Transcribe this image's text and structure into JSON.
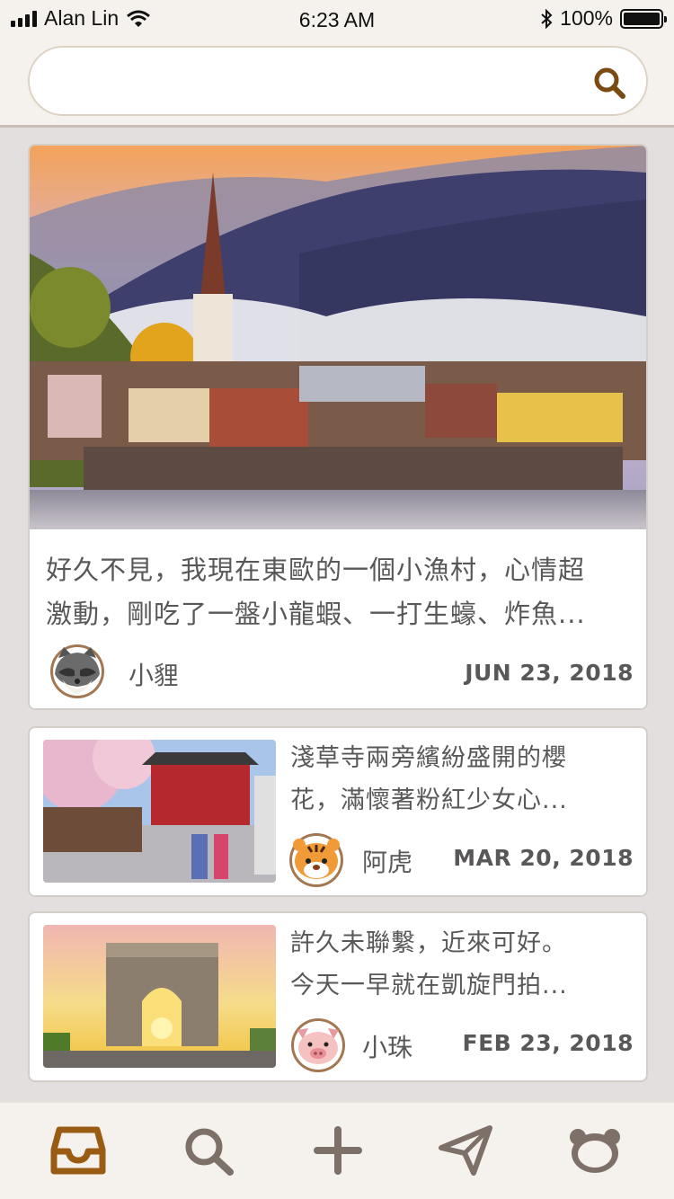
{
  "status_bar": {
    "carrier": "Alan Lin",
    "time": "6:23 AM",
    "battery": "100%"
  },
  "search": {
    "value": "",
    "placeholder": "",
    "icon": "search-icon"
  },
  "posts": [
    {
      "excerpt_lines": [
        "好久不見，我現在東歐的一個小漁村，心情超",
        "激動，剛吃了一盤小龍蝦、一打生蠔、炸魚..."
      ],
      "author": "小貍",
      "avatar": "raccoon-avatar",
      "date": "JUN 23, 2018"
    },
    {
      "excerpt_lines": [
        "淺草寺兩旁繽紛盛開的櫻",
        "花，滿懷著粉紅少女心..."
      ],
      "author": "阿虎",
      "avatar": "tiger-avatar",
      "date": "MAR 20, 2018"
    },
    {
      "excerpt_lines": [
        "許久未聯繫，近來可好。",
        "今天一早就在凱旋門拍..."
      ],
      "author": "小珠",
      "avatar": "pig-avatar",
      "date": "FEB 23, 2018"
    }
  ],
  "tab_bar": {
    "tabs": [
      "inbox-icon",
      "search-icon",
      "plus-icon",
      "send-icon",
      "bear-icon"
    ],
    "active": "inbox-icon"
  },
  "colors": {
    "accent": "#9a5b13",
    "icon_inactive": "#7d7068",
    "text": "#595757",
    "background": "#e3dfdf"
  }
}
